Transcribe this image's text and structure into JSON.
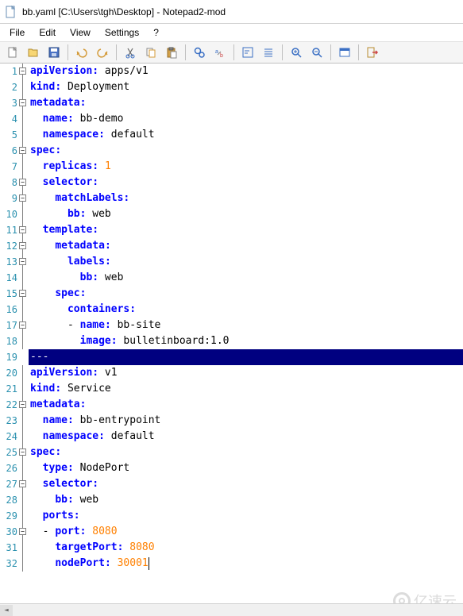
{
  "window": {
    "title": "bb.yaml [C:\\Users\\tgh\\Desktop] - Notepad2-mod"
  },
  "menu": {
    "file": "File",
    "edit": "Edit",
    "view": "View",
    "settings": "Settings",
    "help": "?"
  },
  "code_lines": [
    {
      "n": 1,
      "fold": "box",
      "tokens": [
        [
          "key",
          "apiVersion"
        ],
        [
          "colon",
          ":"
        ],
        [
          "str",
          " apps/v1"
        ]
      ]
    },
    {
      "n": 2,
      "fold": "line",
      "tokens": [
        [
          "key",
          "kind"
        ],
        [
          "colon",
          ":"
        ],
        [
          "str",
          " Deployment"
        ]
      ]
    },
    {
      "n": 3,
      "fold": "box",
      "tokens": [
        [
          "key",
          "metadata"
        ],
        [
          "colon",
          ":"
        ]
      ]
    },
    {
      "n": 4,
      "fold": "line",
      "tokens": [
        [
          "str",
          "  "
        ],
        [
          "key",
          "name"
        ],
        [
          "colon",
          ":"
        ],
        [
          "str",
          " bb-demo"
        ]
      ]
    },
    {
      "n": 5,
      "fold": "line",
      "tokens": [
        [
          "str",
          "  "
        ],
        [
          "key",
          "namespace"
        ],
        [
          "colon",
          ":"
        ],
        [
          "str",
          " default"
        ]
      ]
    },
    {
      "n": 6,
      "fold": "box",
      "tokens": [
        [
          "key",
          "spec"
        ],
        [
          "colon",
          ":"
        ]
      ]
    },
    {
      "n": 7,
      "fold": "line",
      "tokens": [
        [
          "str",
          "  "
        ],
        [
          "key",
          "replicas"
        ],
        [
          "colon",
          ":"
        ],
        [
          "str",
          " "
        ],
        [
          "num-val",
          "1"
        ]
      ]
    },
    {
      "n": 8,
      "fold": "box",
      "tokens": [
        [
          "str",
          "  "
        ],
        [
          "key",
          "selector"
        ],
        [
          "colon",
          ":"
        ]
      ]
    },
    {
      "n": 9,
      "fold": "box",
      "tokens": [
        [
          "str",
          "    "
        ],
        [
          "key",
          "matchLabels"
        ],
        [
          "colon",
          ":"
        ]
      ]
    },
    {
      "n": 10,
      "fold": "line",
      "tokens": [
        [
          "str",
          "      "
        ],
        [
          "key",
          "bb"
        ],
        [
          "colon",
          ":"
        ],
        [
          "str",
          " web"
        ]
      ]
    },
    {
      "n": 11,
      "fold": "box",
      "tokens": [
        [
          "str",
          "  "
        ],
        [
          "key",
          "template"
        ],
        [
          "colon",
          ":"
        ]
      ]
    },
    {
      "n": 12,
      "fold": "box",
      "tokens": [
        [
          "str",
          "    "
        ],
        [
          "key",
          "metadata"
        ],
        [
          "colon",
          ":"
        ]
      ]
    },
    {
      "n": 13,
      "fold": "box",
      "tokens": [
        [
          "str",
          "      "
        ],
        [
          "key",
          "labels"
        ],
        [
          "colon",
          ":"
        ]
      ]
    },
    {
      "n": 14,
      "fold": "line",
      "tokens": [
        [
          "str",
          "        "
        ],
        [
          "key",
          "bb"
        ],
        [
          "colon",
          ":"
        ],
        [
          "str",
          " web"
        ]
      ]
    },
    {
      "n": 15,
      "fold": "box",
      "tokens": [
        [
          "str",
          "    "
        ],
        [
          "key",
          "spec"
        ],
        [
          "colon",
          ":"
        ]
      ]
    },
    {
      "n": 16,
      "fold": "line",
      "tokens": [
        [
          "str",
          "      "
        ],
        [
          "key",
          "containers"
        ],
        [
          "colon",
          ":"
        ]
      ]
    },
    {
      "n": 17,
      "fold": "box",
      "tokens": [
        [
          "str",
          "      - "
        ],
        [
          "key",
          "name"
        ],
        [
          "colon",
          ":"
        ],
        [
          "str",
          " bb-site"
        ]
      ]
    },
    {
      "n": 18,
      "fold": "line",
      "tokens": [
        [
          "str",
          "        "
        ],
        [
          "key",
          "image"
        ],
        [
          "colon",
          ":"
        ],
        [
          "str",
          " bulletinboard:1.0"
        ]
      ]
    },
    {
      "n": 19,
      "fold": "none",
      "sel": true,
      "raw": "---"
    },
    {
      "n": 20,
      "fold": "line",
      "tokens": [
        [
          "key",
          "apiVersion"
        ],
        [
          "colon",
          ":"
        ],
        [
          "str",
          " v1"
        ]
      ]
    },
    {
      "n": 21,
      "fold": "line",
      "tokens": [
        [
          "key",
          "kind"
        ],
        [
          "colon",
          ":"
        ],
        [
          "str",
          " Service"
        ]
      ]
    },
    {
      "n": 22,
      "fold": "box",
      "tokens": [
        [
          "key",
          "metadata"
        ],
        [
          "colon",
          ":"
        ]
      ]
    },
    {
      "n": 23,
      "fold": "line",
      "tokens": [
        [
          "str",
          "  "
        ],
        [
          "key",
          "name"
        ],
        [
          "colon",
          ":"
        ],
        [
          "str",
          " bb-entrypoint"
        ]
      ]
    },
    {
      "n": 24,
      "fold": "line",
      "tokens": [
        [
          "str",
          "  "
        ],
        [
          "key",
          "namespace"
        ],
        [
          "colon",
          ":"
        ],
        [
          "str",
          " default"
        ]
      ]
    },
    {
      "n": 25,
      "fold": "box",
      "tokens": [
        [
          "key",
          "spec"
        ],
        [
          "colon",
          ":"
        ]
      ]
    },
    {
      "n": 26,
      "fold": "line",
      "tokens": [
        [
          "str",
          "  "
        ],
        [
          "key",
          "type"
        ],
        [
          "colon",
          ":"
        ],
        [
          "str",
          " NodePort"
        ]
      ]
    },
    {
      "n": 27,
      "fold": "box",
      "tokens": [
        [
          "str",
          "  "
        ],
        [
          "key",
          "selector"
        ],
        [
          "colon",
          ":"
        ]
      ]
    },
    {
      "n": 28,
      "fold": "line",
      "tokens": [
        [
          "str",
          "    "
        ],
        [
          "key",
          "bb"
        ],
        [
          "colon",
          ":"
        ],
        [
          "str",
          " web"
        ]
      ]
    },
    {
      "n": 29,
      "fold": "line",
      "tokens": [
        [
          "str",
          "  "
        ],
        [
          "key",
          "ports"
        ],
        [
          "colon",
          ":"
        ]
      ]
    },
    {
      "n": 30,
      "fold": "box",
      "tokens": [
        [
          "str",
          "  - "
        ],
        [
          "key",
          "port"
        ],
        [
          "colon",
          ":"
        ],
        [
          "str",
          " "
        ],
        [
          "num-val",
          "8080"
        ]
      ]
    },
    {
      "n": 31,
      "fold": "line",
      "tokens": [
        [
          "str",
          "    "
        ],
        [
          "key",
          "targetPort"
        ],
        [
          "colon",
          ":"
        ],
        [
          "str",
          " "
        ],
        [
          "num-val",
          "8080"
        ]
      ]
    },
    {
      "n": 32,
      "fold": "line",
      "tokens": [
        [
          "str",
          "    "
        ],
        [
          "key",
          "nodePort"
        ],
        [
          "colon",
          ":"
        ],
        [
          "str",
          " "
        ],
        [
          "num-val",
          "30001"
        ]
      ],
      "cursor": true
    }
  ],
  "watermark": {
    "text": "亿速云"
  }
}
